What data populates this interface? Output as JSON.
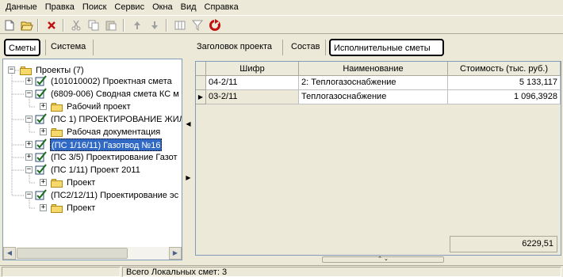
{
  "menu": [
    "Данные",
    "Правка",
    "Поиск",
    "Сервис",
    "Окна",
    "Вид",
    "Справка"
  ],
  "toolbar_icons": [
    "new-doc-icon",
    "open-folder-icon",
    "delete-icon",
    "cut-icon",
    "copy-icon",
    "paste-icon",
    "arrow-up-icon",
    "arrow-down-icon",
    "columns-icon",
    "filter-icon",
    "refresh-icon"
  ],
  "left_tabs": {
    "smety": "Сметы",
    "sistema": "Система"
  },
  "right_tabs": {
    "zagolovok": "Заголовок проекта",
    "sostav": "Состав",
    "ispolnitelnye": "Исполнительные сметы"
  },
  "tree": {
    "root": "Проекты (7)",
    "items": [
      "(101010002) Проектная смета",
      "(6809-006) Сводная смета КС  м",
      "Рабочий проект",
      "(ПС 1) ПРОЕКТИРОВАНИЕ ЖИЛ",
      "Рабочая документация",
      "(ПС 1/16/11) Газотвод №16",
      "(ПС 3/5) Проектирование Газот",
      "(ПС 1/11) Проект 2011",
      "Проект",
      "(ПС2/12/11) Проектирование эс",
      "Проект"
    ]
  },
  "grid": {
    "columns": [
      "Шифр",
      "Наименование",
      "Стоимость (тыс. руб.)"
    ],
    "rows": [
      [
        "04-2/11",
        "2: Теплогазоснабжение",
        "5 133,117"
      ],
      [
        "03-2/11",
        "Теплогазоснабжение",
        "1 096,3928"
      ]
    ],
    "total": "6229,51"
  },
  "status": {
    "text": "Всего Локальных смет: 3"
  },
  "colors": {
    "selection": "#316ac5",
    "panel_bg": "#ece9d8",
    "border": "#7f9db9"
  }
}
